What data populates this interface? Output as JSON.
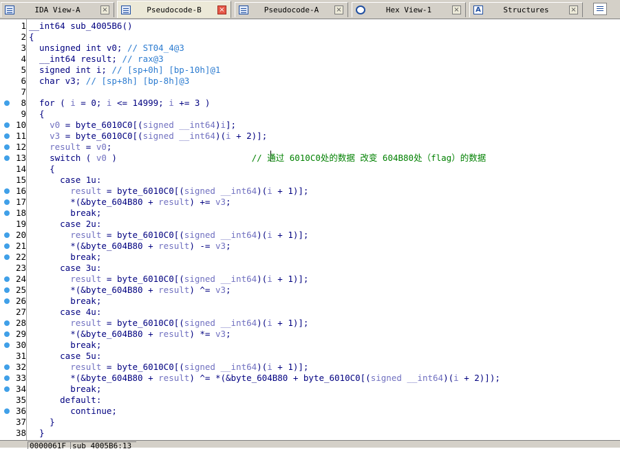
{
  "tabs": [
    {
      "label": "IDA View-A",
      "icon": "doc",
      "active": false
    },
    {
      "label": "Pseudocode-B",
      "icon": "doc",
      "active": true
    },
    {
      "label": "Pseudocode-A",
      "icon": "doc",
      "active": false
    },
    {
      "label": "Hex View-1",
      "icon": "hex",
      "active": false
    },
    {
      "label": "Structures",
      "icon": "struct",
      "active": false
    }
  ],
  "struct_icon_glyph": "A",
  "close_glyph": "×",
  "code_lines": [
    {
      "n": "1",
      "bp": false,
      "tokens": [
        [
          "k",
          "__int64 sub_4005B6()"
        ]
      ]
    },
    {
      "n": "2",
      "bp": false,
      "tokens": [
        [
          "k",
          "{"
        ]
      ]
    },
    {
      "n": "3",
      "bp": false,
      "tokens": [
        [
          "k",
          "  unsigned int v0; "
        ],
        [
          "c",
          "// ST04_4@3"
        ]
      ]
    },
    {
      "n": "4",
      "bp": false,
      "tokens": [
        [
          "k",
          "  __int64 result; "
        ],
        [
          "c",
          "// rax@3"
        ]
      ]
    },
    {
      "n": "5",
      "bp": false,
      "tokens": [
        [
          "k",
          "  signed int i; "
        ],
        [
          "c",
          "// [sp+0h] [bp-10h]@1"
        ]
      ]
    },
    {
      "n": "6",
      "bp": false,
      "tokens": [
        [
          "k",
          "  char v3; "
        ],
        [
          "c",
          "// [sp+8h] [bp-8h]@3"
        ]
      ]
    },
    {
      "n": "7",
      "bp": false,
      "tokens": []
    },
    {
      "n": "8",
      "bp": true,
      "tokens": [
        [
          "k",
          "  for ( "
        ],
        [
          "v",
          "i"
        ],
        [
          "k",
          " = 0; "
        ],
        [
          "v",
          "i"
        ],
        [
          "k",
          " <= 14999; "
        ],
        [
          "v",
          "i"
        ],
        [
          "k",
          " += 3 )"
        ]
      ]
    },
    {
      "n": "9",
      "bp": false,
      "tokens": [
        [
          "k",
          "  {"
        ]
      ]
    },
    {
      "n": "10",
      "bp": true,
      "tokens": [
        [
          "k",
          "    "
        ],
        [
          "v",
          "v0"
        ],
        [
          "k",
          " = byte_6010C0[("
        ],
        [
          "v",
          "signed __int64"
        ],
        [
          "k",
          ")"
        ],
        [
          "v",
          "i"
        ],
        [
          "k",
          "];"
        ]
      ]
    },
    {
      "n": "11",
      "bp": true,
      "tokens": [
        [
          "k",
          "    "
        ],
        [
          "v",
          "v3"
        ],
        [
          "k",
          " = byte_6010C0[("
        ],
        [
          "v",
          "signed __int64"
        ],
        [
          "k",
          ")("
        ],
        [
          "v",
          "i"
        ],
        [
          "k",
          " + 2)];"
        ]
      ]
    },
    {
      "n": "12",
      "bp": true,
      "tokens": [
        [
          "k",
          "    "
        ],
        [
          "v",
          "result"
        ],
        [
          "k",
          " = "
        ],
        [
          "v",
          "v0"
        ],
        [
          "k",
          ";"
        ]
      ]
    },
    {
      "n": "13",
      "bp": true,
      "tokens": [
        [
          "k",
          "    switch ( "
        ],
        [
          "v",
          "v0"
        ],
        [
          "k",
          " )                          "
        ],
        [
          "d",
          "// 通过 6010C0处的数据 改变 604B80处（flag）的数据"
        ]
      ]
    },
    {
      "n": "14",
      "bp": false,
      "tokens": [
        [
          "k",
          "    {"
        ]
      ]
    },
    {
      "n": "15",
      "bp": false,
      "tokens": [
        [
          "k",
          "      case 1u:"
        ]
      ]
    },
    {
      "n": "16",
      "bp": true,
      "tokens": [
        [
          "k",
          "        "
        ],
        [
          "v",
          "result"
        ],
        [
          "k",
          " = byte_6010C0[("
        ],
        [
          "v",
          "signed __int64"
        ],
        [
          "k",
          ")("
        ],
        [
          "v",
          "i"
        ],
        [
          "k",
          " + 1)];"
        ]
      ]
    },
    {
      "n": "17",
      "bp": true,
      "tokens": [
        [
          "k",
          "        *(&byte_604B80 + "
        ],
        [
          "v",
          "result"
        ],
        [
          "k",
          ") += "
        ],
        [
          "v",
          "v3"
        ],
        [
          "k",
          ";"
        ]
      ]
    },
    {
      "n": "18",
      "bp": true,
      "tokens": [
        [
          "k",
          "        break;"
        ]
      ]
    },
    {
      "n": "19",
      "bp": false,
      "tokens": [
        [
          "k",
          "      case 2u:"
        ]
      ]
    },
    {
      "n": "20",
      "bp": true,
      "tokens": [
        [
          "k",
          "        "
        ],
        [
          "v",
          "result"
        ],
        [
          "k",
          " = byte_6010C0[("
        ],
        [
          "v",
          "signed __int64"
        ],
        [
          "k",
          ")("
        ],
        [
          "v",
          "i"
        ],
        [
          "k",
          " + 1)];"
        ]
      ]
    },
    {
      "n": "21",
      "bp": true,
      "tokens": [
        [
          "k",
          "        *(&byte_604B80 + "
        ],
        [
          "v",
          "result"
        ],
        [
          "k",
          ") -= "
        ],
        [
          "v",
          "v3"
        ],
        [
          "k",
          ";"
        ]
      ]
    },
    {
      "n": "22",
      "bp": true,
      "tokens": [
        [
          "k",
          "        break;"
        ]
      ]
    },
    {
      "n": "23",
      "bp": false,
      "tokens": [
        [
          "k",
          "      case 3u:"
        ]
      ]
    },
    {
      "n": "24",
      "bp": true,
      "tokens": [
        [
          "k",
          "        "
        ],
        [
          "v",
          "result"
        ],
        [
          "k",
          " = byte_6010C0[("
        ],
        [
          "v",
          "signed __int64"
        ],
        [
          "k",
          ")("
        ],
        [
          "v",
          "i"
        ],
        [
          "k",
          " + 1)];"
        ]
      ]
    },
    {
      "n": "25",
      "bp": true,
      "tokens": [
        [
          "k",
          "        *(&byte_604B80 + "
        ],
        [
          "v",
          "result"
        ],
        [
          "k",
          ") ^= "
        ],
        [
          "v",
          "v3"
        ],
        [
          "k",
          ";"
        ]
      ]
    },
    {
      "n": "26",
      "bp": true,
      "tokens": [
        [
          "k",
          "        break;"
        ]
      ]
    },
    {
      "n": "27",
      "bp": false,
      "tokens": [
        [
          "k",
          "      case 4u:"
        ]
      ]
    },
    {
      "n": "28",
      "bp": true,
      "tokens": [
        [
          "k",
          "        "
        ],
        [
          "v",
          "result"
        ],
        [
          "k",
          " = byte_6010C0[("
        ],
        [
          "v",
          "signed __int64"
        ],
        [
          "k",
          ")("
        ],
        [
          "v",
          "i"
        ],
        [
          "k",
          " + 1)];"
        ]
      ]
    },
    {
      "n": "29",
      "bp": true,
      "tokens": [
        [
          "k",
          "        *(&byte_604B80 + "
        ],
        [
          "v",
          "result"
        ],
        [
          "k",
          ") *= "
        ],
        [
          "v",
          "v3"
        ],
        [
          "k",
          ";"
        ]
      ]
    },
    {
      "n": "30",
      "bp": true,
      "tokens": [
        [
          "k",
          "        break;"
        ]
      ]
    },
    {
      "n": "31",
      "bp": false,
      "tokens": [
        [
          "k",
          "      case 5u:"
        ]
      ]
    },
    {
      "n": "32",
      "bp": true,
      "tokens": [
        [
          "k",
          "        "
        ],
        [
          "v",
          "result"
        ],
        [
          "k",
          " = byte_6010C0[("
        ],
        [
          "v",
          "signed __int64"
        ],
        [
          "k",
          ")("
        ],
        [
          "v",
          "i"
        ],
        [
          "k",
          " + 1)];"
        ]
      ]
    },
    {
      "n": "33",
      "bp": true,
      "tokens": [
        [
          "k",
          "        *(&byte_604B80 + "
        ],
        [
          "v",
          "result"
        ],
        [
          "k",
          ") ^= *(&byte_604B80 + byte_6010C0[("
        ],
        [
          "v",
          "signed __int64"
        ],
        [
          "k",
          ")("
        ],
        [
          "v",
          "i"
        ],
        [
          "k",
          " + 2)]);"
        ]
      ]
    },
    {
      "n": "34",
      "bp": true,
      "tokens": [
        [
          "k",
          "        break;"
        ]
      ]
    },
    {
      "n": "35",
      "bp": false,
      "tokens": [
        [
          "k",
          "      default:"
        ]
      ]
    },
    {
      "n": "36",
      "bp": true,
      "tokens": [
        [
          "k",
          "        continue;"
        ]
      ]
    },
    {
      "n": "37",
      "bp": false,
      "tokens": [
        [
          "k",
          "    }"
        ]
      ]
    },
    {
      "n": "38",
      "bp": false,
      "tokens": [
        [
          "k",
          "  }"
        ]
      ]
    }
  ],
  "status": {
    "address": "0000061F",
    "location": "sub_4005B6:13"
  },
  "colors": {
    "keyword": "#000080",
    "variable": "#7070c0",
    "comment": "#2b7bd0",
    "chinese_comment": "#008000",
    "breakpoint": "#40a0e8"
  }
}
